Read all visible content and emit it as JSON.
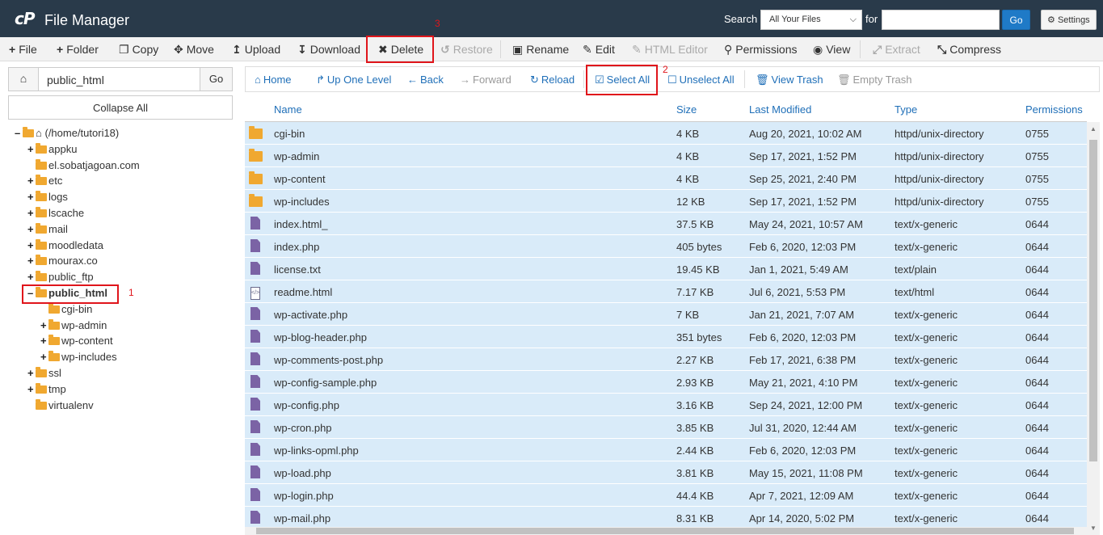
{
  "header": {
    "logo": "cP",
    "title": "File Manager",
    "search_label": "Search",
    "search_scope": "All Your Files",
    "for_label": "for",
    "search_value": "",
    "go_label": "Go",
    "settings_label": "Settings"
  },
  "toolbar": {
    "file": "File",
    "folder": "Folder",
    "copy": "Copy",
    "move": "Move",
    "upload": "Upload",
    "download": "Download",
    "delete": "Delete",
    "restore": "Restore",
    "rename": "Rename",
    "edit": "Edit",
    "html_editor": "HTML Editor",
    "permissions": "Permissions",
    "view": "View",
    "extract": "Extract",
    "compress": "Compress"
  },
  "annotations": {
    "one": "1",
    "two": "2",
    "three": "3"
  },
  "sidebar": {
    "path_value": "public_html",
    "go_label": "Go",
    "collapse_label": "Collapse All",
    "root": "(/home/tutori18)",
    "items": [
      "appku",
      "el.sobatjagoan.com",
      "etc",
      "logs",
      "lscache",
      "mail",
      "moodledata",
      "mourax.co",
      "public_ftp",
      "public_html",
      "cgi-bin",
      "wp-admin",
      "wp-content",
      "wp-includes",
      "ssl",
      "tmp",
      "virtualenv"
    ]
  },
  "nav": {
    "home": "Home",
    "up": "Up One Level",
    "back": "Back",
    "forward": "Forward",
    "reload": "Reload",
    "select_all": "Select All",
    "unselect_all": "Unselect All",
    "view_trash": "View Trash",
    "empty_trash": "Empty Trash"
  },
  "columns": {
    "name": "Name",
    "size": "Size",
    "modified": "Last Modified",
    "type": "Type",
    "permissions": "Permissions"
  },
  "files": [
    {
      "icon": "folder",
      "name": "cgi-bin",
      "size": "4 KB",
      "modified": "Aug 20, 2021, 10:02 AM",
      "type": "httpd/unix-directory",
      "perm": "0755"
    },
    {
      "icon": "folder",
      "name": "wp-admin",
      "size": "4 KB",
      "modified": "Sep 17, 2021, 1:52 PM",
      "type": "httpd/unix-directory",
      "perm": "0755"
    },
    {
      "icon": "folder",
      "name": "wp-content",
      "size": "4 KB",
      "modified": "Sep 25, 2021, 2:40 PM",
      "type": "httpd/unix-directory",
      "perm": "0755"
    },
    {
      "icon": "folder",
      "name": "wp-includes",
      "size": "12 KB",
      "modified": "Sep 17, 2021, 1:52 PM",
      "type": "httpd/unix-directory",
      "perm": "0755"
    },
    {
      "icon": "file",
      "name": "index.html_",
      "size": "37.5 KB",
      "modified": "May 24, 2021, 10:57 AM",
      "type": "text/x-generic",
      "perm": "0644"
    },
    {
      "icon": "file",
      "name": "index.php",
      "size": "405 bytes",
      "modified": "Feb 6, 2020, 12:03 PM",
      "type": "text/x-generic",
      "perm": "0644"
    },
    {
      "icon": "file",
      "name": "license.txt",
      "size": "19.45 KB",
      "modified": "Jan 1, 2021, 5:49 AM",
      "type": "text/plain",
      "perm": "0644"
    },
    {
      "icon": "code",
      "name": "readme.html",
      "size": "7.17 KB",
      "modified": "Jul 6, 2021, 5:53 PM",
      "type": "text/html",
      "perm": "0644"
    },
    {
      "icon": "file",
      "name": "wp-activate.php",
      "size": "7 KB",
      "modified": "Jan 21, 2021, 7:07 AM",
      "type": "text/x-generic",
      "perm": "0644"
    },
    {
      "icon": "file",
      "name": "wp-blog-header.php",
      "size": "351 bytes",
      "modified": "Feb 6, 2020, 12:03 PM",
      "type": "text/x-generic",
      "perm": "0644"
    },
    {
      "icon": "file",
      "name": "wp-comments-post.php",
      "size": "2.27 KB",
      "modified": "Feb 17, 2021, 6:38 PM",
      "type": "text/x-generic",
      "perm": "0644"
    },
    {
      "icon": "file",
      "name": "wp-config-sample.php",
      "size": "2.93 KB",
      "modified": "May 21, 2021, 4:10 PM",
      "type": "text/x-generic",
      "perm": "0644"
    },
    {
      "icon": "file",
      "name": "wp-config.php",
      "size": "3.16 KB",
      "modified": "Sep 24, 2021, 12:00 PM",
      "type": "text/x-generic",
      "perm": "0644"
    },
    {
      "icon": "file",
      "name": "wp-cron.php",
      "size": "3.85 KB",
      "modified": "Jul 31, 2020, 12:44 AM",
      "type": "text/x-generic",
      "perm": "0644"
    },
    {
      "icon": "file",
      "name": "wp-links-opml.php",
      "size": "2.44 KB",
      "modified": "Feb 6, 2020, 12:03 PM",
      "type": "text/x-generic",
      "perm": "0644"
    },
    {
      "icon": "file",
      "name": "wp-load.php",
      "size": "3.81 KB",
      "modified": "May 15, 2021, 11:08 PM",
      "type": "text/x-generic",
      "perm": "0644"
    },
    {
      "icon": "file",
      "name": "wp-login.php",
      "size": "44.4 KB",
      "modified": "Apr 7, 2021, 12:09 AM",
      "type": "text/x-generic",
      "perm": "0644"
    },
    {
      "icon": "file",
      "name": "wp-mail.php",
      "size": "8.31 KB",
      "modified": "Apr 14, 2020, 5:02 PM",
      "type": "text/x-generic",
      "perm": "0644"
    }
  ]
}
